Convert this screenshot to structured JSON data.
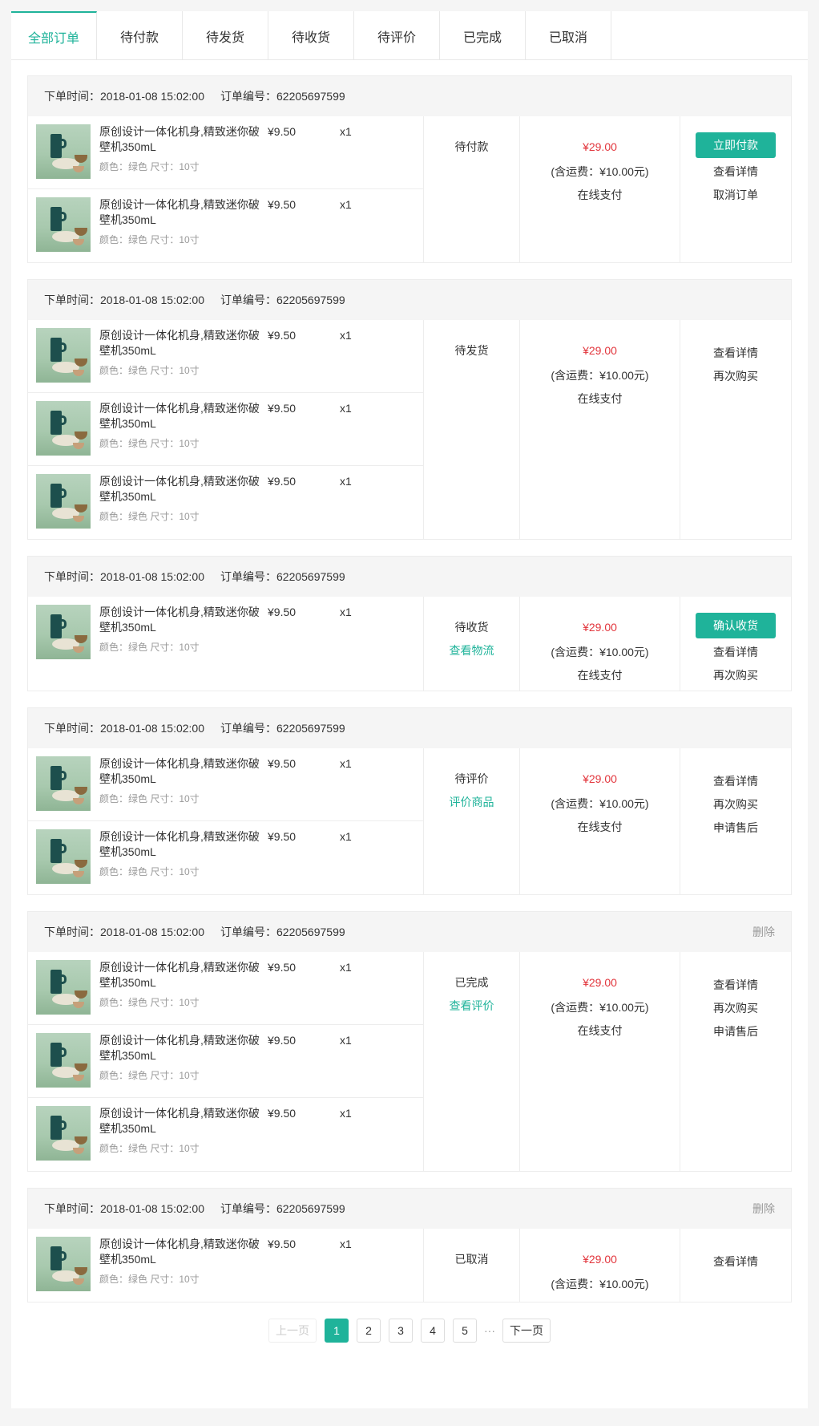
{
  "tabs": [
    {
      "label": "全部订单",
      "active": true
    },
    {
      "label": "待付款",
      "active": false
    },
    {
      "label": "待发货",
      "active": false
    },
    {
      "label": "待收货",
      "active": false
    },
    {
      "label": "待评价",
      "active": false
    },
    {
      "label": "已完成",
      "active": false
    },
    {
      "label": "已取消",
      "active": false
    }
  ],
  "common": {
    "time": "下单时间：2018-01-08 15:02:00",
    "order_no": "订单编号：62205697599",
    "product_name": "原创设计一体化机身,精致迷你破壁机350mL",
    "product_spec": "颜色：绿色 尺寸：10寸",
    "price": "¥9.50",
    "qty": "x1",
    "total": "¥29.00",
    "shipping": "(含运费：¥10.00元)",
    "pay_method": "在线支付"
  },
  "orders": [
    {
      "items": 2,
      "status": "待付款",
      "status_link": "",
      "show_pay": true,
      "delete": "",
      "primary_btn": "立即付款",
      "ops": [
        "查看详情",
        "取消订单"
      ]
    },
    {
      "items": 3,
      "status": "待发货",
      "status_link": "",
      "show_pay": true,
      "delete": "",
      "primary_btn": "",
      "ops": [
        "查看详情",
        "再次购买"
      ]
    },
    {
      "items": 1,
      "status": "待收货",
      "status_link": "查看物流",
      "show_pay": true,
      "delete": "",
      "primary_btn": "确认收货",
      "ops": [
        "查看详情",
        "再次购买"
      ]
    },
    {
      "items": 2,
      "status": "待评价",
      "status_link": "评价商品",
      "show_pay": true,
      "delete": "",
      "primary_btn": "",
      "ops": [
        "查看详情",
        "再次购买",
        "申请售后"
      ]
    },
    {
      "items": 3,
      "status": "已完成",
      "status_link": "查看评价",
      "show_pay": true,
      "delete": "删除",
      "primary_btn": "",
      "ops": [
        "查看详情",
        "再次购买",
        "申请售后"
      ]
    },
    {
      "items": 1,
      "status": "已取消",
      "status_link": "",
      "show_pay": false,
      "delete": "删除",
      "primary_btn": "",
      "ops": [
        "查看详情"
      ]
    }
  ],
  "pagination": {
    "prev": "上一页",
    "pages": [
      "1",
      "2",
      "3",
      "4",
      "5"
    ],
    "current": "1",
    "ellipsis": "···",
    "next": "下一页"
  },
  "colors": {
    "accent": "#1fb39a",
    "price": "#e2363d"
  }
}
